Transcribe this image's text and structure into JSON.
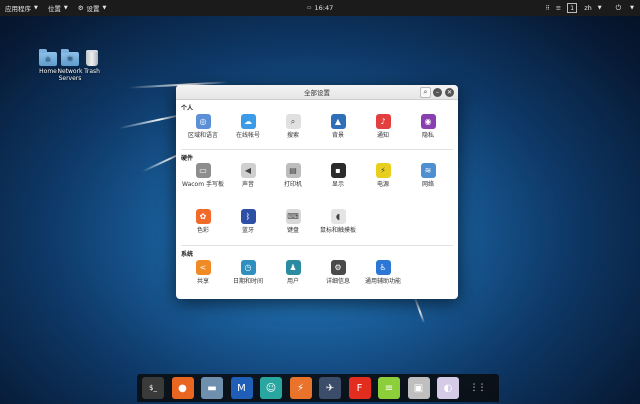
{
  "topbar": {
    "apps_menu": "应用程序",
    "places_menu": "位置",
    "settings_menu": "设置",
    "clock": "16:47",
    "workspace": "1",
    "language": "zh"
  },
  "desktop": {
    "icons": [
      {
        "label": "Home",
        "icon": "home-folder-icon"
      },
      {
        "label": "Network Servers",
        "icon": "network-folder-icon"
      },
      {
        "label": "Trash",
        "icon": "trash-icon"
      }
    ]
  },
  "window": {
    "title": "全部设置",
    "sections": {
      "personal": {
        "title": "个人",
        "items": [
          {
            "label": "区域和语言",
            "icon": "region-language-icon",
            "color": "#5b8fd6"
          },
          {
            "label": "在线帐号",
            "icon": "online-accounts-icon",
            "color": "#3b9be8"
          },
          {
            "label": "搜索",
            "icon": "search-icon",
            "color": "#e0e0e0"
          },
          {
            "label": "背景",
            "icon": "background-icon",
            "color": "#2f6fb8"
          },
          {
            "label": "通知",
            "icon": "notifications-icon",
            "color": "#e33f3f"
          },
          {
            "label": "隐私",
            "icon": "privacy-icon",
            "color": "#8a3fb0"
          }
        ]
      },
      "hardware": {
        "title": "硬件",
        "items": [
          {
            "label": "Wacom 手写板",
            "icon": "wacom-tablet-icon",
            "color": "#8d8d8d"
          },
          {
            "label": "声音",
            "icon": "sound-icon",
            "color": "#cfcfcf"
          },
          {
            "label": "打印机",
            "icon": "printer-icon",
            "color": "#bdbdbd"
          },
          {
            "label": "显示",
            "icon": "display-icon",
            "color": "#2b2b2b"
          },
          {
            "label": "电源",
            "icon": "power-icon",
            "color": "#e8cf1e"
          },
          {
            "label": "网络",
            "icon": "network-icon",
            "color": "#4d8fd1"
          },
          {
            "label": "色彩",
            "icon": "color-icon",
            "color": "#f26a2a"
          },
          {
            "label": "蓝牙",
            "icon": "bluetooth-icon",
            "color": "#2d4fa6"
          },
          {
            "label": "键盘",
            "icon": "keyboard-icon",
            "color": "#d8d8d8"
          },
          {
            "label": "鼠标和触摸板",
            "icon": "mouse-touchpad-icon",
            "color": "#e4e4e4"
          }
        ]
      },
      "system": {
        "title": "系统",
        "items": [
          {
            "label": "共享",
            "icon": "sharing-icon",
            "color": "#f08a24"
          },
          {
            "label": "日期和时间",
            "icon": "date-time-icon",
            "color": "#2f8fbf"
          },
          {
            "label": "用户",
            "icon": "users-icon",
            "color": "#2a8ba1"
          },
          {
            "label": "详细信息",
            "icon": "details-icon",
            "color": "#4a4a4a"
          },
          {
            "label": "通用辅助功能",
            "icon": "accessibility-icon",
            "color": "#2c77d6"
          }
        ]
      }
    }
  },
  "dock": {
    "apps": [
      {
        "icon": "terminal-icon",
        "color": "#3a3a3a",
        "glyph": "$_"
      },
      {
        "icon": "firefox-icon",
        "color": "#e8661f",
        "glyph": "●"
      },
      {
        "icon": "files-icon",
        "color": "#6e8fae",
        "glyph": "▬"
      },
      {
        "icon": "maltego-icon",
        "color": "#1f5fb8",
        "glyph": "M"
      },
      {
        "icon": "armitage-icon",
        "color": "#2aa6a0",
        "glyph": "☺"
      },
      {
        "icon": "burpsuite-icon",
        "color": "#e9732a",
        "glyph": "⚡"
      },
      {
        "icon": "metasploit-icon",
        "color": "#3b4d68",
        "glyph": "✈"
      },
      {
        "icon": "faraday-icon",
        "color": "#e22d1f",
        "glyph": "F"
      },
      {
        "icon": "leafpad-icon",
        "color": "#8ccf3a",
        "glyph": "≡"
      },
      {
        "icon": "cherrytree-icon",
        "color": "#bfbfbf",
        "glyph": "▣"
      },
      {
        "icon": "tweaks-icon",
        "color": "#d6cbe6",
        "glyph": "◐"
      },
      {
        "icon": "app-grid-icon",
        "color": "transparent",
        "glyph": "⋮⋮"
      }
    ]
  }
}
